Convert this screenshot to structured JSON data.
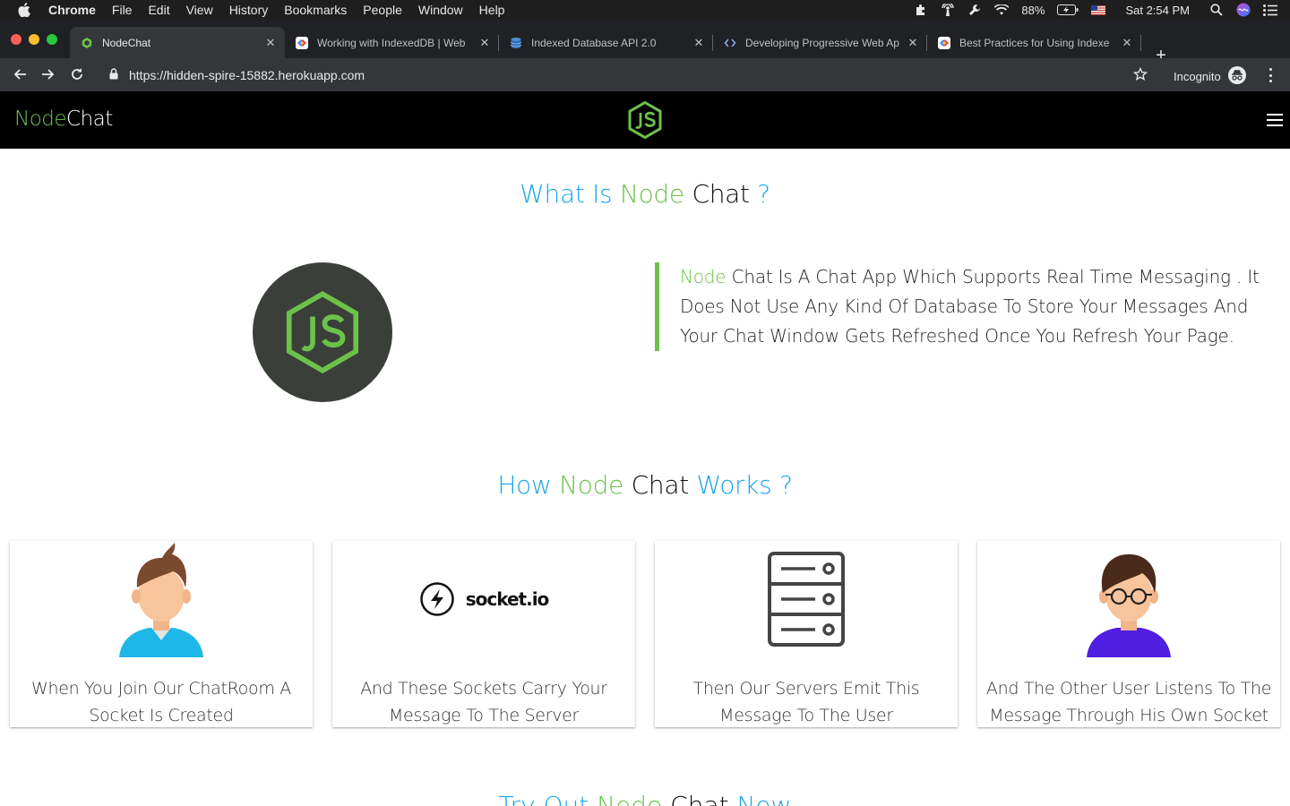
{
  "menubar": {
    "app": "Chrome",
    "items": [
      "File",
      "Edit",
      "View",
      "History",
      "Bookmarks",
      "People",
      "Window",
      "Help"
    ],
    "battery": "88%",
    "clock": "Sat 2:54 PM"
  },
  "tabs": [
    {
      "title": "NodeChat",
      "active": true
    },
    {
      "title": "Working with IndexedDB | Web",
      "active": false
    },
    {
      "title": "Indexed Database API 2.0",
      "active": false
    },
    {
      "title": "Developing Progressive Web Ap",
      "active": false
    },
    {
      "title": "Best Practices for Using Indexe",
      "active": false
    }
  ],
  "toolbar": {
    "url": "https://hidden-spire-15882.herokuapp.com",
    "incognito_label": "Incognito"
  },
  "site": {
    "brand_node": "Node",
    "brand_chat": "Chat"
  },
  "section1": {
    "h_what_is": "What Is",
    "h_node": "Node",
    "h_chat": "Chat",
    "h_q": "?",
    "desc_node": "Node",
    "desc_rest": "Chat Is A Chat App Which Supports Real Time Messaging . It Does Not Use Any Kind Of Database To Store Your Messages And Your Chat Window Gets Refreshed Once You Refresh Your Page."
  },
  "section2": {
    "h_how": "How",
    "h_node": "Node",
    "h_chat": "Chat",
    "h_works": "Works ?",
    "socket_label": "socket.io",
    "cards": [
      {
        "caption": "When You Join Our ChatRoom A Socket Is Created"
      },
      {
        "caption": "And These Sockets Carry Your Message To The Server"
      },
      {
        "caption": "Then Our Servers Emit This Message To The User"
      },
      {
        "caption": "And The Other User Listens To The Message Through His Own Socket"
      }
    ]
  },
  "section3": {
    "h_try_out": "Try Out",
    "h_node": "Node",
    "h_chat": "Chat",
    "h_now": "Now"
  },
  "colors": {
    "node_green": "#6cc24a",
    "heading_blue": "#1aa6e8",
    "navbar_bg": "#000000",
    "node_logo_bg": "#3b3f3a"
  }
}
